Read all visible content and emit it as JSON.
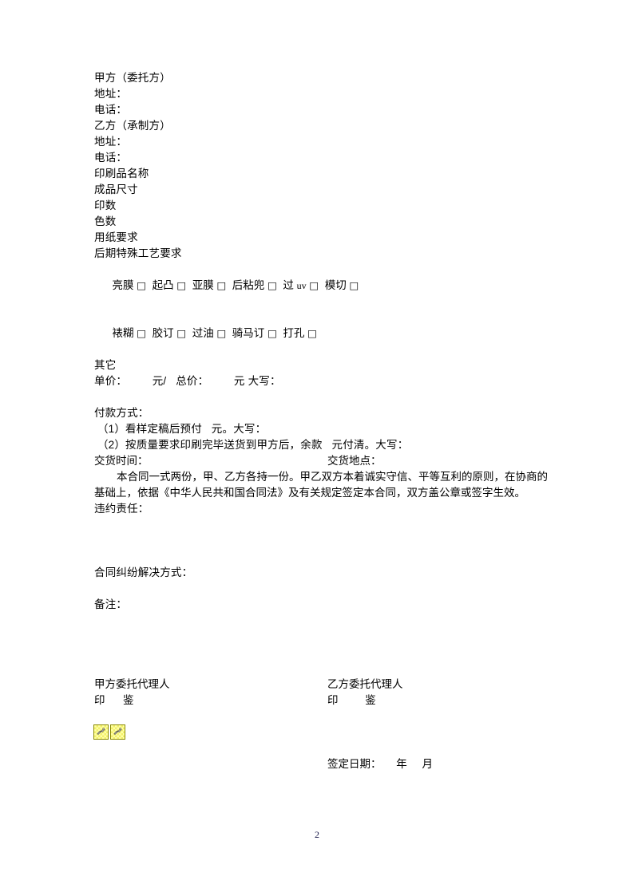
{
  "document": {
    "page_number": "2",
    "parties": {
      "party_a_label": "甲方（委托方）",
      "party_a_address_label": "地址：",
      "party_a_phone_label": "电话：",
      "party_b_label": "乙方（承制方）",
      "party_b_address_label": "地址：",
      "party_b_phone_label": "电话："
    },
    "specs": {
      "product_name_label": "印刷品名称",
      "finished_size_label": "成品尺寸",
      "print_quantity_label": "印数",
      "color_count_label": "色数",
      "paper_requirement_label": "用纸要求",
      "special_process_label": "后期特殊工艺要求"
    },
    "process_options": {
      "row1": [
        {
          "label": "亮膜",
          "box": "□"
        },
        {
          "label": "起凸",
          "box": "□"
        },
        {
          "label": "亚膜",
          "box": "□"
        },
        {
          "label": "后粘兜",
          "box": "□"
        },
        {
          "label": "过 uv",
          "box": "□"
        },
        {
          "label": "模切",
          "box": "□"
        }
      ],
      "row2": [
        {
          "label": "裱糊",
          "box": "□"
        },
        {
          "label": "胶订",
          "box": "□"
        },
        {
          "label": "过油",
          "box": "□"
        },
        {
          "label": "骑马订",
          "box": "□"
        },
        {
          "label": "打孔",
          "box": "□"
        }
      ],
      "other_label": "其它"
    },
    "pricing": {
      "line": "单价：        元/   总价：        元 大写："
    },
    "payment": {
      "heading": "付款方式：",
      "item1": " （1）看样定稿后预付   元。大写：",
      "item2": " （2）按质量要求印刷完毕送货到甲方后，余款   元付清。大写："
    },
    "delivery": {
      "time_label": "交货时间：",
      "place_label": "交货地点："
    },
    "agreement": {
      "paragraph": "本合同一式两份，甲、乙方各持一份。甲乙双方本着诚实守信、平等互利的原则，在协商的基础上，依据《中华人民共和国合同法》及有关规定签定本合同，双方盖公章或签字生效。"
    },
    "clauses": {
      "breach_label": "违约责任：",
      "dispute_label": "合同纠纷解决方式：",
      "remarks_label": "备注："
    },
    "signatures": {
      "party_a_agent_label": "甲方委托代理人",
      "party_a_seal_label": "印      鉴",
      "party_b_agent_label": "乙方委托代理人",
      "party_b_seal_label": "印         鉴",
      "sign_date_label": "签定日期：     年     月"
    },
    "icons": {
      "anchor_1": "anchor-icon",
      "anchor_2": "anchor-icon"
    }
  }
}
